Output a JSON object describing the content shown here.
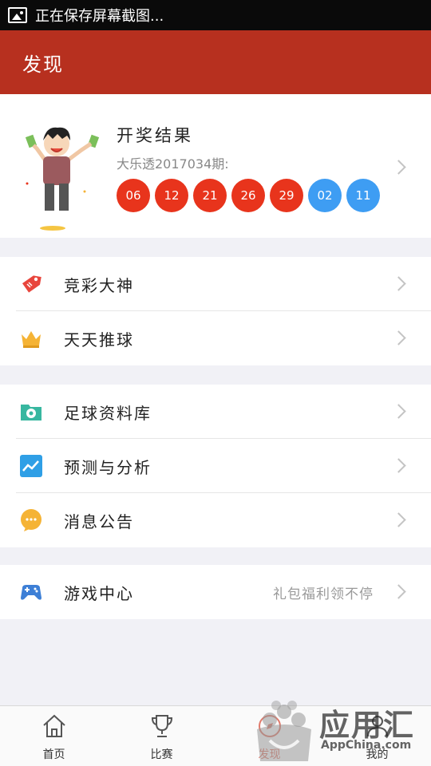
{
  "status_bar": {
    "notification_text": "正在保存屏幕截图..."
  },
  "app_bar": {
    "title": "发现"
  },
  "lottery": {
    "title": "开奖结果",
    "issue": "大乐透2017034期:",
    "red_balls": [
      "06",
      "12",
      "21",
      "26",
      "29"
    ],
    "blue_balls": [
      "02",
      "11"
    ],
    "colors": {
      "red": "#e8341c",
      "blue": "#3e9df3"
    }
  },
  "groups": [
    [
      {
        "label": "竞彩大神",
        "icon": "tag-icon",
        "color": "#e8453c"
      },
      {
        "label": "天天推球",
        "icon": "crown-icon",
        "color": "#f5b335"
      }
    ],
    [
      {
        "label": "足球资料库",
        "icon": "football-folder-icon",
        "color": "#38b7a0"
      },
      {
        "label": "预测与分析",
        "icon": "trend-chart-icon",
        "color": "#2f9fe6"
      },
      {
        "label": "消息公告",
        "icon": "chat-bubble-icon",
        "color": "#f5b335"
      }
    ],
    [
      {
        "label": "游戏中心",
        "icon": "gamepad-icon",
        "color": "#3d7fd6",
        "extra": "礼包福利领不停"
      }
    ]
  ],
  "tab_bar": {
    "tabs": [
      {
        "label": "首页",
        "icon": "home-icon"
      },
      {
        "label": "比赛",
        "icon": "trophy-icon"
      },
      {
        "label": "发现",
        "icon": "discover-icon",
        "active": true
      },
      {
        "label": "我的",
        "icon": "profile-icon"
      }
    ]
  },
  "watermark": {
    "text": "应用汇",
    "sub": "AppChina.com"
  }
}
